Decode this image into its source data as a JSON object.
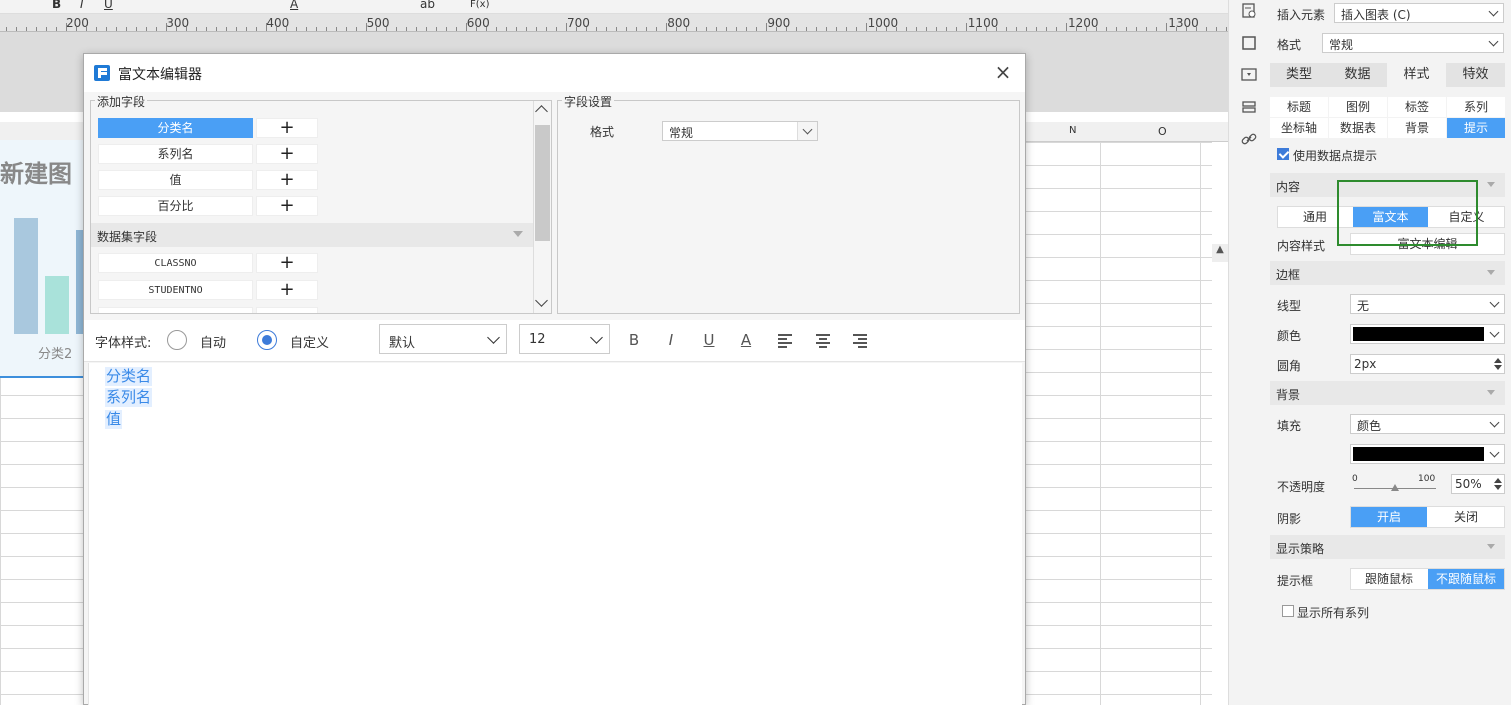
{
  "toolbar": {
    "bold": "B",
    "italic": "I",
    "underline": "U",
    "fx": "F(x)",
    "ab": "ab",
    "font_color_letter": "A"
  },
  "ruler": {
    "marks": [
      "200",
      "300",
      "400",
      "500",
      "600",
      "700",
      "800",
      "900",
      "1000",
      "1100",
      "1200",
      "1300"
    ]
  },
  "sheet": {
    "col_n": "N",
    "col_o": "O"
  },
  "chart_preview": {
    "title": "新建图",
    "category": "分类2"
  },
  "dialog": {
    "title": "富文本编辑器",
    "close": "×",
    "add_field": {
      "legend": "添加字段",
      "fields": [
        {
          "name": "分类名",
          "selected": true
        },
        {
          "name": "系列名"
        },
        {
          "name": "值"
        },
        {
          "name": "百分比"
        }
      ],
      "add_symbol": "+",
      "dataset_header": "数据集字段",
      "dataset_fields": [
        {
          "name": "CLASSNO"
        },
        {
          "name": "STUDENTNO"
        }
      ]
    },
    "field_settings": {
      "legend": "字段设置",
      "format_label": "格式",
      "format_value": "常规"
    },
    "font_bar": {
      "label": "字体样式:",
      "radio_auto": "自动",
      "radio_custom": "自定义",
      "font_family": "默认",
      "font_size": "12",
      "bold": "B",
      "italic": "I",
      "underline": "U",
      "color": "A"
    },
    "editor": {
      "tags": [
        "分类名",
        "系列名",
        "值"
      ]
    }
  },
  "panel": {
    "insert_label": "插入元素",
    "insert_value": "插入图表 (C)",
    "format_label": "格式",
    "format_value": "常规",
    "tabs": [
      {
        "label": "类型"
      },
      {
        "label": "数据"
      },
      {
        "label": "样式",
        "active": true
      },
      {
        "label": "特效"
      }
    ],
    "subtabs_row1": [
      {
        "label": "标题"
      },
      {
        "label": "图例"
      },
      {
        "label": "标签"
      },
      {
        "label": "系列"
      }
    ],
    "subtabs_row2": [
      {
        "label": "坐标轴"
      },
      {
        "label": "数据表"
      },
      {
        "label": "背景"
      },
      {
        "label": "提示",
        "active": true
      }
    ],
    "use_tooltip": "使用数据点提示",
    "content_section": "内容",
    "content_modes": [
      {
        "label": "通用"
      },
      {
        "label": "富文本",
        "active": true
      },
      {
        "label": "自定义"
      }
    ],
    "content_style_label": "内容样式",
    "content_style_button": "富文本编辑",
    "border_section": "边框",
    "line_type_label": "线型",
    "line_type_value": "无",
    "color_label": "颜色",
    "radius_label": "圆角",
    "radius_value": "2px",
    "background_section": "背景",
    "fill_label": "填充",
    "fill_value": "颜色",
    "opacity_label": "不透明度",
    "opacity_min": "0",
    "opacity_max": "100",
    "opacity_value": "50%",
    "opacity_fraction": 0.5,
    "shadow_label": "阴影",
    "shadow_options": [
      {
        "label": "开启",
        "active": true
      },
      {
        "label": "关闭"
      }
    ],
    "display_section": "显示策略",
    "tooltip_box_label": "提示框",
    "tooltip_box_options": [
      {
        "label": "跟随鼠标"
      },
      {
        "label": "不跟随鼠标",
        "active": true
      }
    ],
    "show_all_series": "显示所有系列",
    "colors": {
      "border_color": "#000000",
      "fill_color": "#000000",
      "accent": "#4a9ff5",
      "highlight": "#2e8b2e"
    }
  }
}
